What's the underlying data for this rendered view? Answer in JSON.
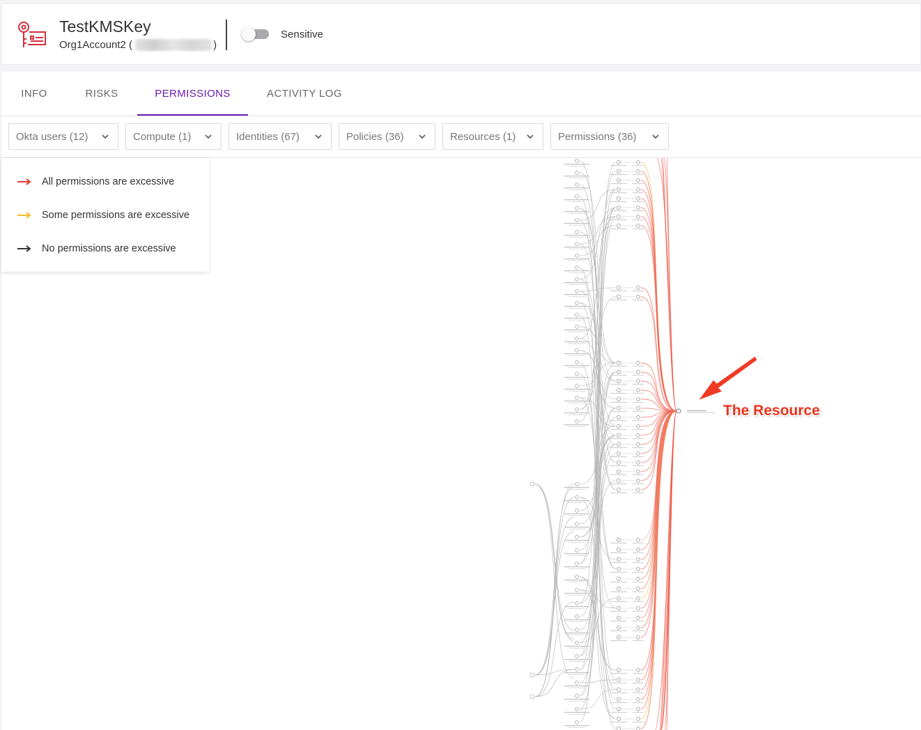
{
  "header": {
    "title": "TestKMSKey",
    "account": "Org1Account2 (",
    "account_suffix": ")",
    "sensitive_label": "Sensitive",
    "sensitive_on": false
  },
  "tabs": [
    {
      "label": "INFO",
      "active": false
    },
    {
      "label": "RISKS",
      "active": false
    },
    {
      "label": "PERMISSIONS",
      "active": true
    },
    {
      "label": "ACTIVITY LOG",
      "active": false
    }
  ],
  "filters": [
    {
      "label": "Okta users (12)"
    },
    {
      "label": "Compute (1)"
    },
    {
      "label": "Identities (67)"
    },
    {
      "label": "Policies (36)"
    },
    {
      "label": "Resources (1)"
    },
    {
      "label": "Permissions (36)"
    }
  ],
  "legend": [
    {
      "label": "All permissions are excessive",
      "color": "#e53935"
    },
    {
      "label": "Some permissions are excessive",
      "color": "#f9b82a"
    },
    {
      "label": "No permissions are excessive",
      "color": "#333333"
    }
  ],
  "annotation": {
    "label": "The Resource",
    "color": "#e8341c"
  },
  "colors": {
    "accent": "#6a1bb0",
    "brand_icon": "#d32f3a"
  }
}
